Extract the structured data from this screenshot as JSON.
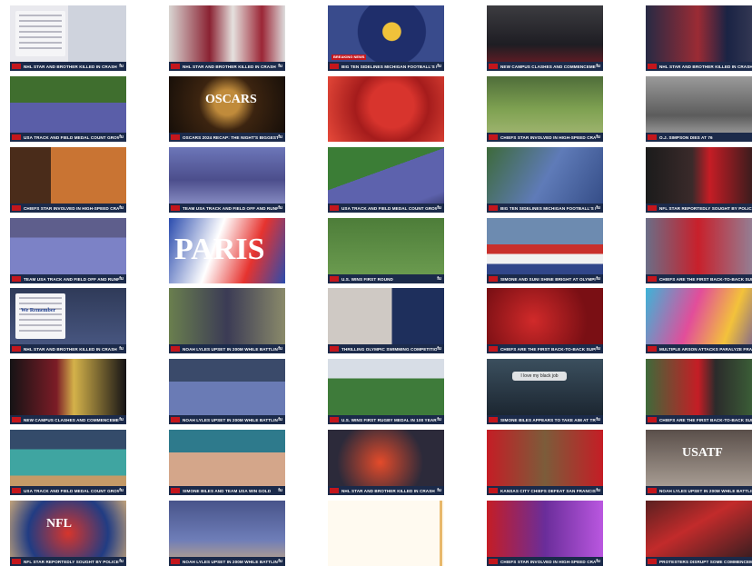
{
  "logo_text": "Fubo",
  "badge_text": "FUBO NEWS",
  "tiles": [
    {
      "caption": "NHL STAR AND BROTHER KILLED IN CRASH",
      "scene": "note-hockey"
    },
    {
      "caption": "NHL STAR AND BROTHER KILLED IN CRASH",
      "scene": "hockey-jerseys"
    },
    {
      "caption": "BIG TEN SIDELINES MICHIGAN FOOTBALL'S HEAD COACH OVER ALLEGED SIGN-STEALING SCHEME",
      "scene": "michigan",
      "banner": "BREAKING NEWS"
    },
    {
      "caption": "NEW CAMPUS CLASHES AND COMMENCEMENTS",
      "scene": "commencement"
    },
    {
      "caption": "NHL STAR AND BROTHER KILLED IN CRASH",
      "scene": "hockey-player"
    },
    {
      "caption": "USA TRACK AND FIELD MEDAL COUNT GROWS",
      "scene": "track-wide"
    },
    {
      "caption": "OSCARS 2024 RECAP: THE NIGHT'S BIGGEST MOMENTS",
      "scene": "oscars",
      "overlay": "OSCARS"
    },
    {
      "caption": "",
      "scene": "football-red"
    },
    {
      "caption": "CHIEFS STAR INVOLVED IN HIGH-SPEED CRASH?",
      "scene": "nfl-field"
    },
    {
      "caption": "O.J. SIMPSON DIES AT 76",
      "scene": "oj-simpson"
    },
    {
      "caption": "CHIEFS STAR INVOLVED IN HIGH-SPEED CRASH?",
      "scene": "portrait-orange"
    },
    {
      "caption": "TEAM USA TRACK AND FIELD OFF AND RUNNING",
      "scene": "runner-close"
    },
    {
      "caption": "USA TRACK AND FIELD MEDAL COUNT GROWS",
      "scene": "track-curve"
    },
    {
      "caption": "BIG TEN SIDELINES MICHIGAN FOOTBALL'S HEAD COACH",
      "scene": "stadium-grid"
    },
    {
      "caption": "NFL STAR REPORTEDLY SOUGHT BY POLICE FOR MAJOR CAR CRASH",
      "scene": "chiefs-player"
    },
    {
      "caption": "TEAM USA TRACK AND FIELD OFF AND RUNNING",
      "scene": "sprint-line"
    },
    {
      "caption": "",
      "scene": "paris",
      "overlay": "PARIS"
    },
    {
      "caption": "U.S. WINS FIRST ROUND",
      "scene": "soccer"
    },
    {
      "caption": "SIMONE AND SUNI SHINE BRIGHT AT OLYMPICS",
      "scene": "flag"
    },
    {
      "caption": "CHIEFS ARE THE FIRST BACK-TO-BACK SUPER BOWL CHAMPIONS SINCE THE NEW ENGLAND PATRIOTS",
      "scene": "mahomes"
    },
    {
      "caption": "NHL STAR AND BROTHER KILLED IN CRASH",
      "scene": "tweet",
      "overlay": "We Remember"
    },
    {
      "caption": "NOAH LYLES UPSET IN 200M WHILE BATTLING COVID",
      "scene": "interview"
    },
    {
      "caption": "THRILLING OLYMPIC SWIMMING COMPETITION",
      "scene": "swimmer"
    },
    {
      "caption": "CHIEFS ARE THE FIRST BACK-TO-BACK SUPER BOWL CHAMPIONS SINCE THE NEW ENGLAND PATRIOTS",
      "scene": "crowd-red"
    },
    {
      "caption": "MULTIPLE ARSON ATTACKS PARALYZE FRANCE'S RAIL NETWORK AHEAD OF OPENING CEREMONY",
      "scene": "colorful-city"
    },
    {
      "caption": "NEW CAMPUS CLASHES AND COMMENCEMENTS",
      "scene": "graduates"
    },
    {
      "caption": "NOAH LYLES UPSET IN 200M WHILE BATTLING COVID",
      "scene": "sprint-start"
    },
    {
      "caption": "U.S. WINS FIRST RUGBY MEDAL IN 100 YEARS",
      "scene": "rugby"
    },
    {
      "caption": "SIMONE BILES APPEARS TO TAKE AIM AT TRUMP",
      "scene": "biles-post",
      "overlay": "I love my black job"
    },
    {
      "caption": "CHIEFS ARE THE FIRST BACK-TO-BACK SUPER BOWL CHAMPIONS SINCE THE NEW ENGLAND PATRIOTS",
      "scene": "chiefs-celebrate"
    },
    {
      "caption": "USA TRACK AND FIELD MEDAL COUNT GROWS",
      "scene": "basketball"
    },
    {
      "caption": "SIMONE BILES AND TEAM USA WIN GOLD",
      "scene": "gym-floor"
    },
    {
      "caption": "NHL STAR AND BROTHER KILLED IN CRASH",
      "scene": "flyers-crowd"
    },
    {
      "caption": "KANSAS CITY CHIEFS DEFEAT SAN FRANCISCO 49ERS IN OVERTIME TO WIN SUPER BOWL LVIII",
      "scene": "superbowl"
    },
    {
      "caption": "NOAH LYLES UPSET IN 200M WHILE BATTLING COVID",
      "scene": "usatf",
      "overlay": "USATF"
    },
    {
      "caption": "NFL STAR REPORTEDLY SOUGHT BY POLICE FOR MAJOR CAR CRASH",
      "scene": "nfl-logo",
      "overlay": "NFL"
    },
    {
      "caption": "NOAH LYLES UPSET IN 200M WHILE BATTLING COVID",
      "scene": "lyles-ground"
    },
    {
      "caption": "",
      "scene": "blank"
    },
    {
      "caption": "CHIEFS STAR INVOLVED IN HIGH-SPEED CRASH?",
      "scene": "chiefs-purple"
    },
    {
      "caption": "PROTESTERS DISRUPT SOME COMMENCEMENTS",
      "scene": "protest"
    }
  ]
}
